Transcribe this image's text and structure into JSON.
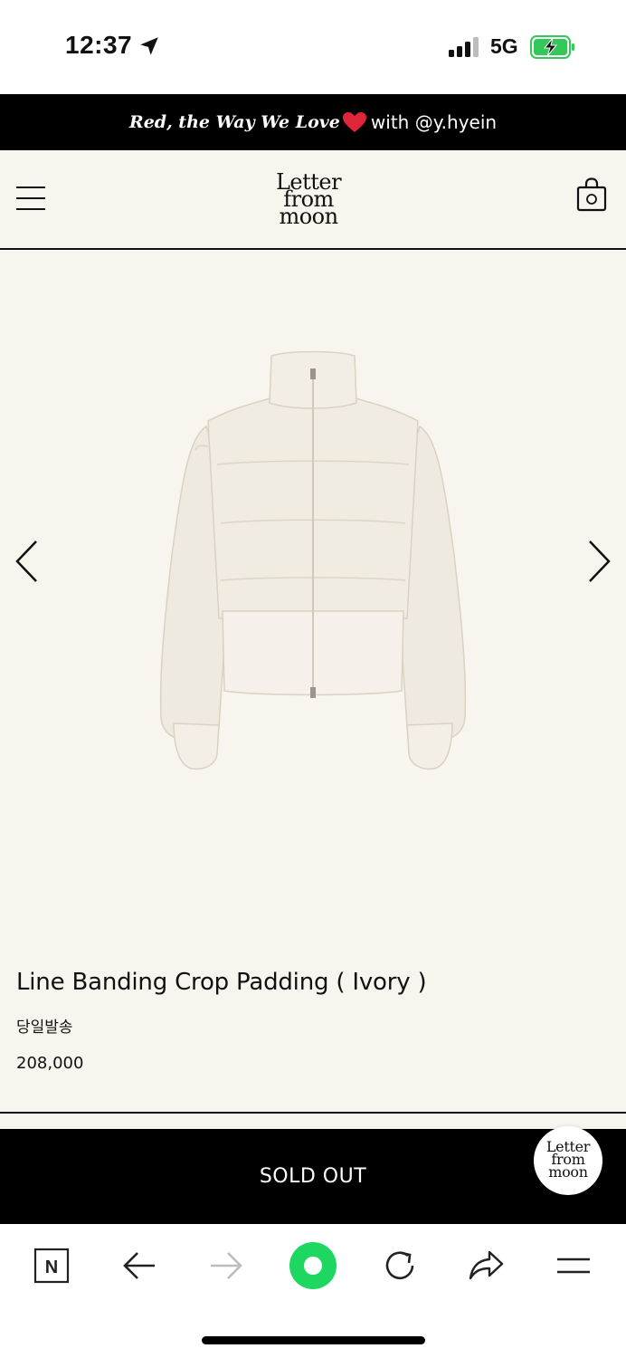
{
  "status_bar": {
    "time": "12:37",
    "network": "5G"
  },
  "promo": {
    "italic_text": "Red, the Way We Love",
    "rest_text": " with @y.hyein"
  },
  "header": {
    "logo_lines": [
      "Letter",
      "from",
      "moon"
    ]
  },
  "product": {
    "title": "Line Banding Crop Padding ( Ivory )",
    "tag": "당일발송",
    "price": "208,000"
  },
  "cta": {
    "label": "SOLD OUT"
  },
  "badge": {
    "logo_lines": [
      "Letter",
      "from",
      "moon"
    ]
  },
  "browser": {
    "home_label": "N"
  },
  "colors": {
    "accent_green": "#1ed760",
    "battery_green": "#34c759",
    "heart_red": "#e0243a",
    "page_bg": "#f8f5ef"
  }
}
